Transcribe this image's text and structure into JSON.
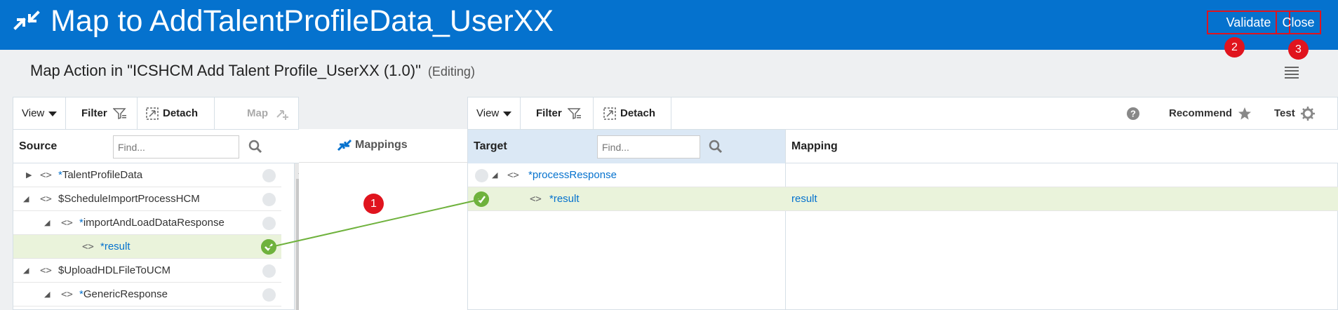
{
  "header": {
    "title": "Map to AddTalentProfileData_UserXX",
    "validate_label": "Validate",
    "close_label": "Close",
    "badge_validate": "2",
    "badge_close": "3",
    "icon": "map-arrows-icon",
    "bg_color": "#0572ce",
    "highlight_color": "#e0141e"
  },
  "subheader": {
    "title": "Map Action in \"ICSHCM Add Talent Profile_UserXX (1.0)\"",
    "status": "(Editing)"
  },
  "source_panel": {
    "toolbar": {
      "view": "View",
      "filter": "Filter",
      "detach": "Detach",
      "map": "Map"
    },
    "column_label": "Source",
    "find_placeholder": "Find...",
    "rows": [
      {
        "name": "*TalentProfileData",
        "prefix": "*",
        "label": "TalentProfileData",
        "expanded": false,
        "level": 0
      },
      {
        "name": "$ScheduleImportProcessHCM",
        "prefix": "",
        "label": "$ScheduleImportProcessHCM",
        "expanded": true,
        "level": 0
      },
      {
        "name": "*importAndLoadDataResponse",
        "prefix": "*",
        "label": "importAndLoadDataResponse",
        "expanded": true,
        "level": 1
      },
      {
        "name": "*result",
        "prefix": "*",
        "label": "result",
        "mapped": true,
        "level": 2
      },
      {
        "name": "$UploadHDLFileToUCM",
        "prefix": "",
        "label": "$UploadHDLFileToUCM",
        "expanded": true,
        "level": 0
      },
      {
        "name": "*GenericResponse",
        "prefix": "*",
        "label": "GenericResponse",
        "expanded": true,
        "level": 1
      }
    ]
  },
  "mappings_panel": {
    "label": "Mappings",
    "badge": "1"
  },
  "target_panel": {
    "toolbar": {
      "view": "View",
      "filter": "Filter",
      "detach": "Detach",
      "recommend": "Recommend",
      "test": "Test"
    },
    "column_target": "Target",
    "column_mapping": "Mapping",
    "find_placeholder": "Find...",
    "rows": [
      {
        "prefix": "*",
        "label": "processResponse",
        "mapping": ""
      },
      {
        "prefix": "*",
        "label": "result",
        "mapping": "result",
        "mapped": true
      }
    ]
  }
}
